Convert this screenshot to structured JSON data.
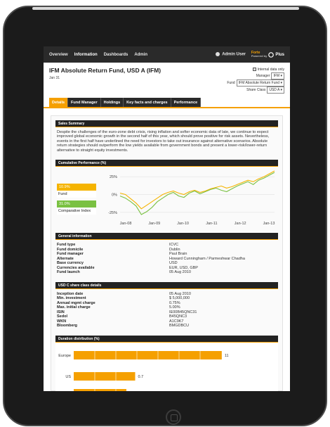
{
  "nav": {
    "items": [
      "Overview",
      "Information",
      "Dashboards",
      "Admin"
    ],
    "user": "Admin User",
    "logo": "Forte",
    "logo_sub": "Powered by",
    "logo_plus": "Plus"
  },
  "header": {
    "title": "IFM Absolute Return Fund, USD A (IFM)",
    "date": "Jan 31",
    "internal_label": "Internal data only",
    "manager_label": "Manager",
    "manager_value": "IFM",
    "fund_label": "Fund",
    "fund_value": "IFM Absolute Return Fund",
    "share_class_label": "Share Class",
    "share_class_value": "USD A"
  },
  "tabs": [
    "Details",
    "Fund Manager",
    "Holdings",
    "Key facts and charges",
    "Performance"
  ],
  "sales": {
    "title": "Sales Summary",
    "text": "Despite the challenges of the euro-zone debt crisis, rising inflation and softer economic data of late, we continue to expect improved global economic growth in the second half of this year, which should prove positive for risk assets. Nevertheless, events in the first half have underlined the need for investors to take out insurance against alternative scenarios. Absolute return strategies should outperform the low yields available from government bonds and present a lower-risk/lower-return alternative to straight equity investments."
  },
  "performance": {
    "title": "Cumulative Performance (%)",
    "legend": [
      {
        "value": "10.9%",
        "label": "Fund",
        "color": "#f5b400"
      },
      {
        "value": "31.0%",
        "label": "Comparative Index",
        "color": "#7ac142"
      }
    ]
  },
  "general": {
    "title": "General information",
    "rows": [
      {
        "key": "Fund type",
        "value": "ICVC"
      },
      {
        "key": "Fund domicile",
        "value": "Dublin"
      },
      {
        "key": "Fund manager",
        "value": "Paul Brain"
      },
      {
        "key": "Alternate",
        "value": "Howard Cunningham / Parmeshwar Chadha"
      },
      {
        "key": "Base currency",
        "value": "USD"
      },
      {
        "key": "Currencies available",
        "value": "EUR, USD, GBP"
      },
      {
        "key": "Fund launch",
        "value": "05 Aug 2010"
      }
    ]
  },
  "share": {
    "title": "USD C share class details",
    "rows": [
      {
        "key": "Inception date",
        "value": "05 Aug 2010"
      },
      {
        "key": "Min. investment",
        "value": "$ 5,000,000"
      },
      {
        "key": "Annual mgmt charge",
        "value": "0.75%"
      },
      {
        "key": "Max. initial charge",
        "value": "5.00%"
      },
      {
        "key": "ISIN",
        "value": "IE00B45QNC31"
      },
      {
        "key": "Sedol",
        "value": "B45QNC3"
      },
      {
        "key": "WKN",
        "value": "A1C9K7"
      },
      {
        "key": "Bloomberg",
        "value": "BMGDBCU"
      }
    ]
  },
  "duration": {
    "title": "Duration distribution (%)"
  },
  "chart_data": [
    {
      "type": "line",
      "title": "Cumulative Performance (%)",
      "x_ticks": [
        "Jan-08",
        "Jan-09",
        "Jan-10",
        "Jan-11",
        "Jan-12",
        "Jan-13"
      ],
      "y_ticks": [
        "25%",
        "0%",
        "-25%"
      ],
      "ylim": [
        -30,
        35
      ],
      "series": [
        {
          "name": "Fund",
          "color": "#f5b400",
          "values": [
            2,
            0,
            -6,
            -12,
            -20,
            -15,
            -10,
            -5,
            0,
            3,
            5,
            2,
            0,
            4,
            6,
            3,
            5,
            8,
            10,
            12,
            9,
            11,
            14,
            17,
            20,
            18,
            22,
            25,
            29,
            33
          ]
        },
        {
          "name": "Comparative Index",
          "color": "#7ac142",
          "values": [
            -2,
            -5,
            -10,
            -16,
            -28,
            -24,
            -18,
            -10,
            -5,
            0,
            3,
            -2,
            -4,
            2,
            5,
            1,
            4,
            7,
            9,
            6,
            4,
            8,
            12,
            15,
            18,
            14,
            20,
            23,
            27,
            31
          ]
        }
      ]
    },
    {
      "type": "bar",
      "title": "Duration distribution (%)",
      "categories": [
        "Europe",
        "US",
        ""
      ],
      "values": [
        11,
        0.7,
        0.6
      ],
      "value_labels": [
        "11",
        "0.7",
        ""
      ]
    }
  ]
}
